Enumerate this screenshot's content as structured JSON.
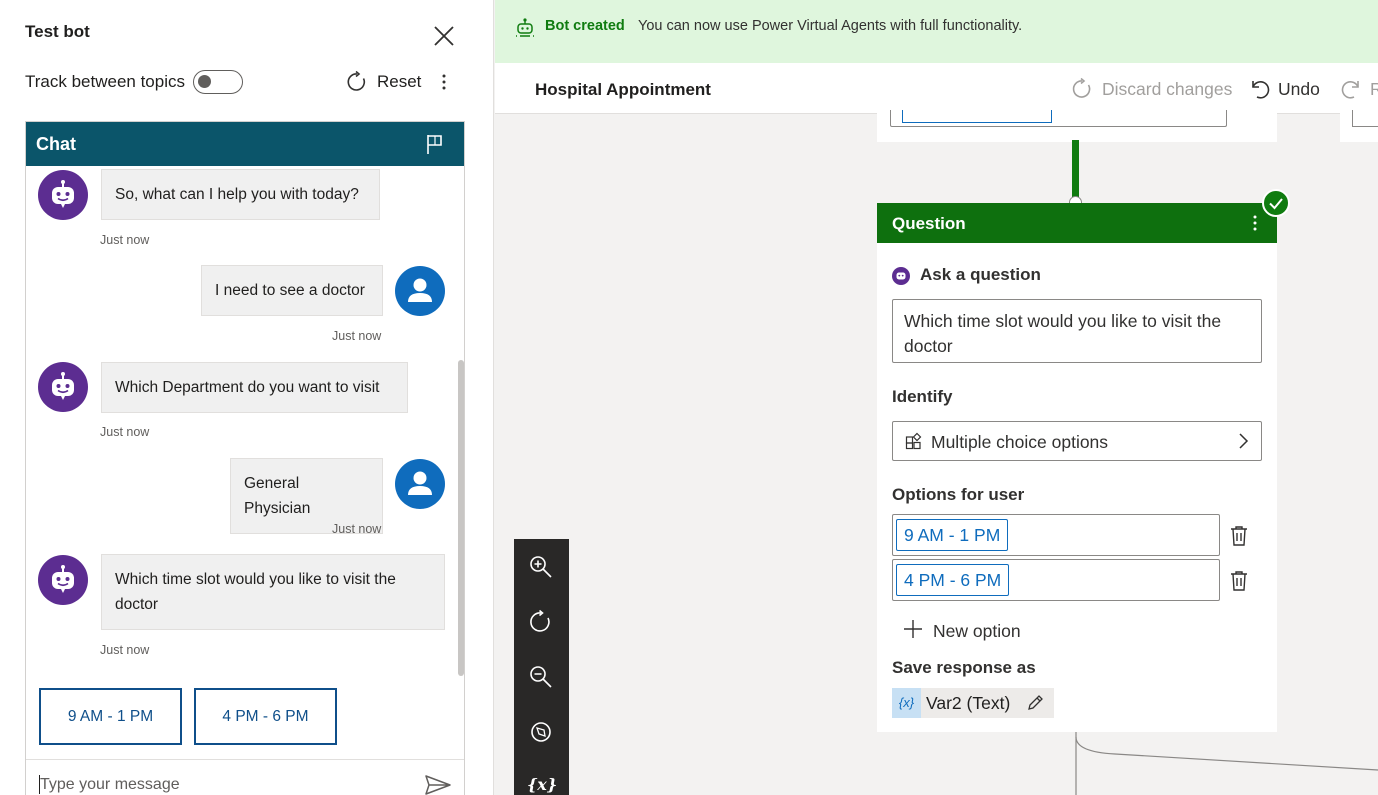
{
  "test_panel": {
    "title": "Test bot",
    "track_label": "Track between topics",
    "reset_label": "Reset"
  },
  "chat": {
    "header": "Chat",
    "messages": [
      {
        "from": "bot",
        "text": "So, what can I help you with today?",
        "time": "Just now"
      },
      {
        "from": "user",
        "text": "I need to see a doctor",
        "time": "Just now"
      },
      {
        "from": "bot",
        "text": "Which Department do you want to visit",
        "time": "Just now"
      },
      {
        "from": "user",
        "text": "General Physician",
        "time": "Just now"
      },
      {
        "from": "bot",
        "text": "Which time slot would you like to visit the doctor",
        "time": "Just now"
      }
    ],
    "suggested_actions": [
      "9 AM - 1 PM",
      "4 PM - 6 PM"
    ],
    "input_placeholder": "Type your message"
  },
  "banner": {
    "title": "Bot created",
    "message": "You can now use Power Virtual Agents with full functionality."
  },
  "topbar": {
    "topic_name": "Hospital Appointment",
    "discard_label": "Discard changes",
    "undo_label": "Undo",
    "redo_label": "R"
  },
  "question_node": {
    "header": "Question",
    "ask_label": "Ask a question",
    "question_text": "Which time slot would you like to visit the doctor",
    "identify_label": "Identify",
    "identify_value": "Multiple choice options",
    "options_label": "Options for user",
    "options": [
      "9 AM - 1 PM",
      "4 PM - 6 PM"
    ],
    "new_option_label": "New option",
    "save_label": "Save response as",
    "variable_icon_text": "{x}",
    "variable": "Var2 (Text)"
  },
  "zoom_controls": {
    "variables_label": "{x}"
  },
  "colors": {
    "chat_header": "#0b556a",
    "bot_avatar": "#5c2d91",
    "user_avatar": "#0f6cbd",
    "question_header": "#0e700e",
    "banner_bg": "#dff6dd",
    "success_green": "#107c10"
  },
  "icons": [
    "close-icon",
    "reset-icon",
    "more-icon",
    "flag-icon",
    "bot-icon",
    "person-icon",
    "send-icon",
    "bot-created-icon",
    "discard-icon",
    "undo-icon",
    "redo-icon",
    "check-icon",
    "question-bot-icon",
    "options-icon",
    "chevron-right-icon",
    "trash-icon",
    "plus-icon",
    "edit-icon",
    "zoom-in-icon",
    "reset-view-icon",
    "zoom-out-icon",
    "compass-icon",
    "variables-icon"
  ]
}
